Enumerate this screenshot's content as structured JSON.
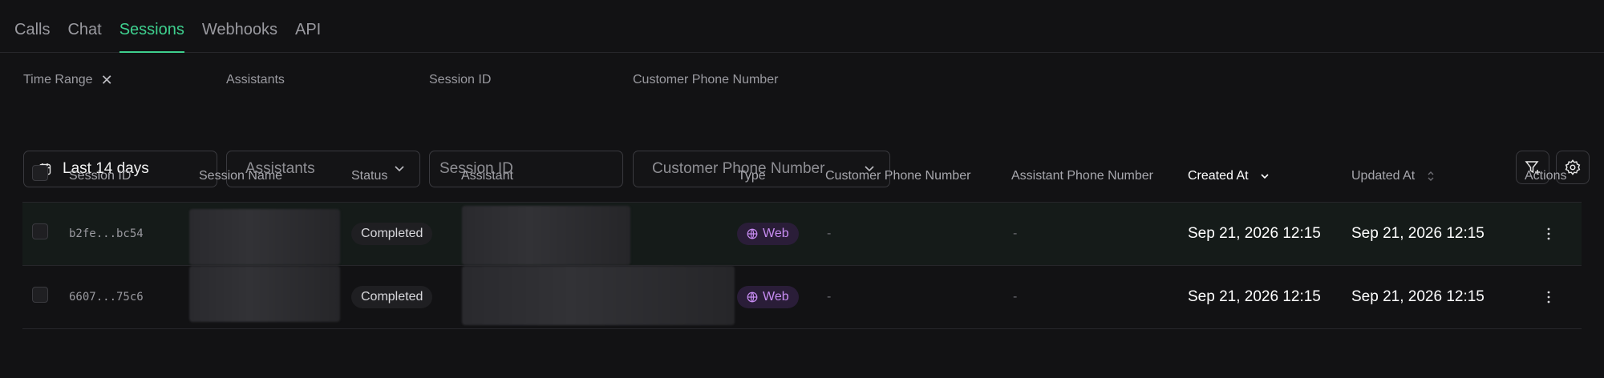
{
  "tabs": [
    {
      "label": "Calls",
      "active": false
    },
    {
      "label": "Chat",
      "active": false
    },
    {
      "label": "Sessions",
      "active": true
    },
    {
      "label": "Webhooks",
      "active": false
    },
    {
      "label": "API",
      "active": false
    }
  ],
  "filters": {
    "time_range": {
      "label": "Time Range",
      "clear_icon": "close-icon",
      "value": "Last 14 days",
      "icon": "calendar-icon"
    },
    "assistants": {
      "label": "Assistants",
      "placeholder": "Assistants",
      "icon": "chevron-down-icon"
    },
    "session_id": {
      "label": "Session ID",
      "placeholder": "Session ID"
    },
    "customer_phone": {
      "label": "Customer Phone Number",
      "placeholder": "Customer Phone Number",
      "icon": "chevron-down-icon"
    }
  },
  "toolbar": {
    "filter_icon": "filter-plus-icon",
    "settings_icon": "gear-icon"
  },
  "table": {
    "columns": [
      "Session ID",
      "Session Name",
      "Status",
      "Assistant",
      "Type",
      "Customer Phone Number",
      "Assistant Phone Number",
      "Created At",
      "Updated At",
      "Actions"
    ],
    "sorted_column": "Created At",
    "rows": [
      {
        "session_id": "b2fe...bc54",
        "session_name": "",
        "status": "Completed",
        "assistant": "",
        "type": "Web",
        "customer_phone": "-",
        "assistant_phone": "-",
        "created_at": "Sep 21, 2026 12:15",
        "updated_at": "Sep 21, 2026 12:15"
      },
      {
        "session_id": "6607...75c6",
        "session_name": "",
        "status": "Completed",
        "assistant": "",
        "type": "Web",
        "customer_phone": "-",
        "assistant_phone": "-",
        "created_at": "Sep 21, 2026 12:15",
        "updated_at": "Sep 21, 2026 12:15"
      }
    ]
  },
  "colors": {
    "accent": "#3ecf8e",
    "background": "#121214",
    "web_badge": "#c78cf2"
  }
}
